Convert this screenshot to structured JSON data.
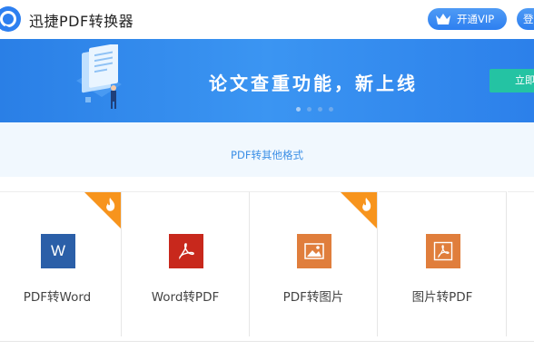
{
  "header": {
    "title": "迅捷PDF转换器",
    "vip_label": "开通VIP",
    "login_label": "登"
  },
  "banner": {
    "text": "论文查重功能，新上线",
    "button_label": "立即",
    "dots": 4
  },
  "section": {
    "title": "PDF转其他格式"
  },
  "tools": [
    {
      "label": "PDF转Word",
      "icon": "word-icon",
      "hot": true
    },
    {
      "label": "Word转PDF",
      "icon": "pdf-icon",
      "hot": false
    },
    {
      "label": "PDF转图片",
      "icon": "image-icon",
      "hot": true
    },
    {
      "label": "图片转PDF",
      "icon": "image-to-pdf-icon",
      "hot": false
    }
  ],
  "colors": {
    "brand_blue": "#2d7ff0",
    "banner_button": "#24c3a3",
    "hot_tag": "#f7941d",
    "word_blue": "#2b5fa8",
    "pdf_red": "#c8281c",
    "image_orange": "#e07e3c"
  }
}
